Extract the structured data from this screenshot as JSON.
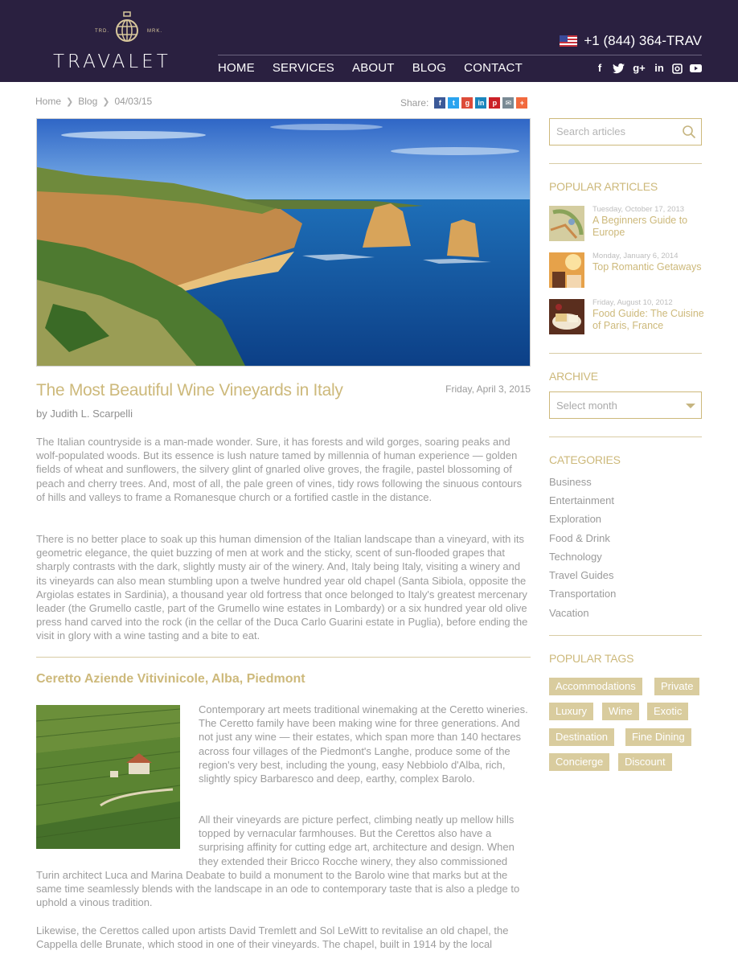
{
  "brand": {
    "name": "TRAVALET",
    "tm_left": "TRD.",
    "tm_right": "MRK."
  },
  "header": {
    "phone": "+1 (844) 364-TRAV",
    "nav": [
      "HOME",
      "SERVICES",
      "ABOUT",
      "BLOG",
      "CONTACT"
    ],
    "social_icons": [
      "facebook-icon",
      "twitter-icon",
      "google-plus-icon",
      "linkedin-icon",
      "instagram-icon",
      "youtube-icon"
    ],
    "bg_color": "#2a2040"
  },
  "breadcrumb": {
    "items": [
      "Home",
      "Blog",
      "04/03/15"
    ]
  },
  "share": {
    "label": "Share:",
    "buttons": [
      "facebook-icon",
      "twitter-icon",
      "google-plus-icon",
      "linkedin-icon",
      "pinterest-icon",
      "email-icon",
      "more-icon"
    ]
  },
  "article": {
    "title": "The Most Beautiful Wine Vineyards in Italy",
    "date": "Friday, April 3, 2015",
    "author": "by Judith L. Scarpelli",
    "p1": "The Italian countryside is a man-made wonder. Sure, it has forests and wild gorges, soaring peaks and wolf-populated woods. But its essence is lush nature tamed by millennia of human experience — golden fields of wheat and sunflowers, the silvery glint of gnarled olive groves, the fragile, pastel blossoming of peach and cherry trees. And, most of all, the pale green of vines, tidy rows following the sinuous contours of hills and valleys to frame a Romanesque church or a fortified castle in the distance.",
    "p2": "There is no better place to soak up this human dimension of the Italian landscape than a vineyard, with its geometric elegance, the quiet buzzing of men at work and the sticky, scent of sun-flooded grapes that sharply contrasts with the dark, slightly musty air of the winery. And, Italy being Italy, visiting a winery and its vineyards can also mean stumbling upon a twelve hundred year old chapel (Santa Sibiola, opposite the Argiolas estates in Sardinia), a thousand year old fortress that once belonged to Italy's greatest mercenary leader (the Grumello castle, part of the Grumello wine estates in Lombardy) or a six hundred year old olive press hand carved into the rock (in the cellar of the Duca Carlo Guarini estate in Puglia), before ending the visit in glory with a wine tasting and a bite to eat.",
    "section_title": "Ceretto Aziende Vitivinicole, Alba, Piedmont",
    "p3": "Contemporary art meets traditional winemaking at the Ceretto wineries. The Ceretto family have been making wine for three generations. And not just any wine — their estates, which span more than 140 hectares across four villages of the Piedmont's Langhe, produce some of the region's very best, including the young, easy Nebbiolo d'Alba, rich, slightly spicy Barbaresco and deep, earthy, complex Barolo.",
    "p4_a": "All their vineyards are picture perfect, climbing neatly up mellow hills topped by vernacular farmhouses. But the Cerettos also have a surprising affinity for cutting edge art, architecture and design. When they extended their Bricco Rocche winery, they also commissioned",
    "p4_b": "Turin architect Luca and Marina Deabate to build a monument to the Barolo wine  that marks but at the same time seamlessly blends with the landscape in an ode to contemporary taste that is also a pledge to uphold a vinous tradition.",
    "p5": "Likewise, the Cerettos called upon artists David Tremlett and Sol LeWitt to revitalise an old chapel, the Cappella delle Brunate, which stood in one of their vineyards. The chapel, built in 1914 by the local"
  },
  "sidebar": {
    "search_placeholder": "Search articles",
    "popular_heading": "POPULAR ARTICLES",
    "popular": [
      {
        "date": "Tuesday, October 17, 2013",
        "title": "A Beginners Guide to Europe"
      },
      {
        "date": "Monday, January 6, 2014",
        "title": "Top Romantic Getaways"
      },
      {
        "date": "Friday, August 10, 2012",
        "title": "Food Guide: The Cuisine of Paris, France"
      }
    ],
    "archive_heading": "ARCHIVE",
    "archive_select": "Select month",
    "categories_heading": "CATEGORIES",
    "categories": [
      "Business",
      "Entertainment",
      "Exploration",
      "Food & Drink",
      "Technology",
      "Travel Guides",
      "Transportation",
      "Vacation"
    ],
    "tags_heading": "POPULAR TAGS",
    "tags": [
      "Accommodations",
      "Private",
      "Luxury",
      "Wine",
      "Exotic",
      "Destination",
      "Fine Dining",
      "Concierge",
      "Discount"
    ],
    "accent_color": "#cdb97b"
  }
}
